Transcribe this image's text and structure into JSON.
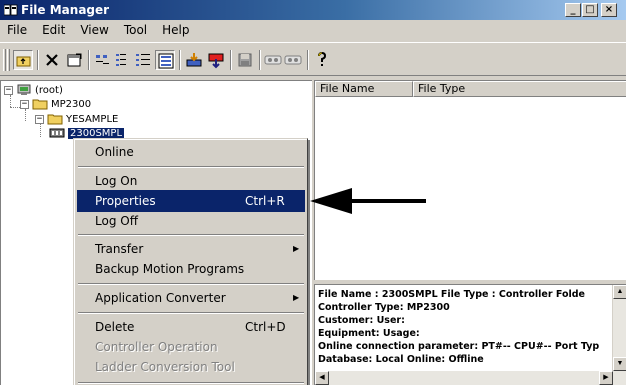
{
  "window": {
    "title": "File Manager",
    "controls": [
      "_",
      "□",
      "×"
    ]
  },
  "menubar": [
    "File",
    "Edit",
    "View",
    "Tool",
    "Help"
  ],
  "toolbar": {
    "icons": [
      "up-folder-icon",
      "delete-icon",
      "properties-icon",
      "small-icons-icon",
      "list-view-icon",
      "detail-view-icon",
      "large-icons-icon",
      "download-icon",
      "upload-icon",
      "save-icon",
      "tape-icon",
      "tape2-icon",
      "help-icon"
    ]
  },
  "tree": {
    "root": "(root)",
    "controller": "MP2300",
    "folder": "YESAMPLE",
    "program": "2300SMPL"
  },
  "list": {
    "columns": [
      "File Name",
      "File Type"
    ]
  },
  "info": {
    "lines": [
      "File Name : 2300SMPL        File Type : Controller Folde",
      "Controller Type: MP2300",
      "Customer:                              User:",
      "Equipment:                             Usage:",
      "Online connection parameter: PT#-- CPU#--    Port Typ",
      "Database: Local  Online: Offline"
    ]
  },
  "context_menu": {
    "items": [
      {
        "label": "Online",
        "shortcut": "",
        "submenu": false,
        "state": "normal"
      },
      {
        "label": "Log On",
        "shortcut": "",
        "submenu": false,
        "state": "normal"
      },
      {
        "label": "Properties",
        "shortcut": "Ctrl+R",
        "submenu": false,
        "state": "highlighted"
      },
      {
        "label": "Log Off",
        "shortcut": "",
        "submenu": false,
        "state": "normal"
      },
      {
        "label": "Transfer",
        "shortcut": "",
        "submenu": true,
        "state": "normal"
      },
      {
        "label": "Backup Motion Programs",
        "shortcut": "",
        "submenu": false,
        "state": "normal"
      },
      {
        "label": "Application Converter",
        "shortcut": "",
        "submenu": true,
        "state": "normal"
      },
      {
        "label": "Delete",
        "shortcut": "Ctrl+D",
        "submenu": false,
        "state": "normal"
      },
      {
        "label": "Controller Operation",
        "shortcut": "",
        "submenu": false,
        "state": "disabled"
      },
      {
        "label": "Ladder Conversion Tool",
        "shortcut": "",
        "submenu": false,
        "state": "disabled"
      }
    ]
  },
  "colors": {
    "titlebar_start": "#0a246a",
    "titlebar_end": "#a6caf0",
    "highlight": "#0a246a",
    "face": "#d4d0c8"
  }
}
